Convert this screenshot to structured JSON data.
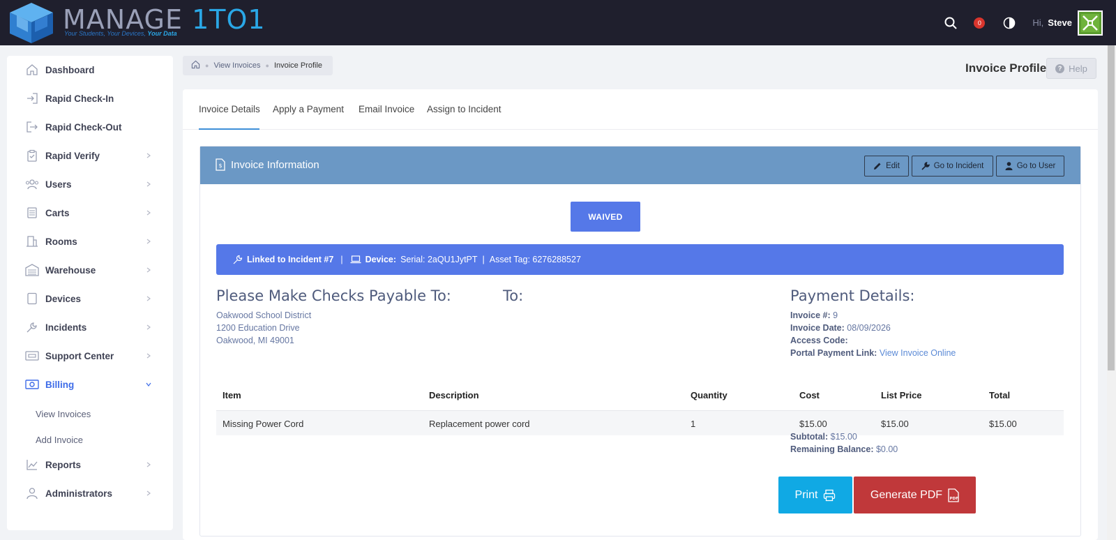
{
  "app": {
    "logo_word_main": "MANAGE ",
    "logo_word_accent": "1TO1",
    "logo_tagline_main": "Your Students, Your Devices, ",
    "logo_tagline_accent": "Your Data",
    "notification_count": "0",
    "greeting": "Hi,",
    "username": "Steve"
  },
  "sidebar": {
    "items": [
      {
        "label": "Dashboard",
        "icon": "home-icon"
      },
      {
        "label": "Rapid Check-In",
        "icon": "sign-in-icon"
      },
      {
        "label": "Rapid Check-Out",
        "icon": "sign-out-icon"
      },
      {
        "label": "Rapid Verify",
        "icon": "clipboard-check-icon"
      },
      {
        "label": "Users",
        "icon": "users-icon"
      },
      {
        "label": "Carts",
        "icon": "cart-icon"
      },
      {
        "label": "Rooms",
        "icon": "building-icon"
      },
      {
        "label": "Warehouse",
        "icon": "warehouse-icon"
      },
      {
        "label": "Devices",
        "icon": "tablet-icon"
      },
      {
        "label": "Incidents",
        "icon": "wrench-icon"
      },
      {
        "label": "Support Center",
        "icon": "support-icon"
      },
      {
        "label": "Billing",
        "icon": "money-icon"
      },
      {
        "label": "Reports",
        "icon": "chart-icon"
      },
      {
        "label": "Administrators",
        "icon": "admin-icon"
      }
    ],
    "billing_sub": [
      "View Invoices",
      "Add Invoice"
    ]
  },
  "breadcrumb": {
    "link": "View Invoices",
    "current": "Invoice Profile"
  },
  "page_title": "Invoice Profile",
  "help_label": "Help",
  "tabs": [
    "Invoice Details",
    "Apply a Payment",
    "Email Invoice",
    "Assign to Incident"
  ],
  "invoice_panel": {
    "title": "Invoice Information",
    "buttons": {
      "edit": "Edit",
      "go_incident": "Go to Incident",
      "go_user": "Go to User"
    },
    "status": "WAIVED",
    "linked": {
      "incident": "Linked to Incident #7",
      "device_label": "Device:",
      "serial": "Serial: 2aQU1JytPT",
      "asset": "Asset Tag: 6276288527"
    },
    "payable": {
      "heading": "Please Make Checks Payable To:",
      "lines": [
        "Oakwood School District",
        "1200 Education Drive",
        "Oakwood, MI 49001"
      ]
    },
    "to_heading": "To:",
    "payment": {
      "heading": "Payment Details:",
      "invoice_num_label": "Invoice #:",
      "invoice_num": "9",
      "invoice_date_label": "Invoice Date:",
      "invoice_date": "08/09/2026",
      "access_code_label": "Access Code:",
      "access_code": "",
      "portal_label": "Portal Payment Link:",
      "portal_link": "View Invoice Online"
    },
    "table": {
      "headers": [
        "Item",
        "Description",
        "Quantity",
        "Cost",
        "List Price",
        "Total"
      ],
      "rows": [
        [
          "Missing Power Cord",
          "Replacement power cord",
          "1",
          "$15.00",
          "$15.00",
          "$15.00"
        ]
      ]
    },
    "totals": {
      "subtotal_label": "Subtotal:",
      "subtotal": "$15.00",
      "remaining_label": "Remaining Balance:",
      "remaining": "$0.00"
    },
    "print_label": "Print",
    "pdf_label": "Generate PDF"
  },
  "colors": {
    "topbar": "#1f1f2d",
    "accent": "#3e6ce8",
    "panel_header": "#6b98c5",
    "status": "#5578e8",
    "print": "#10a9e4",
    "pdf": "#c0383a"
  }
}
